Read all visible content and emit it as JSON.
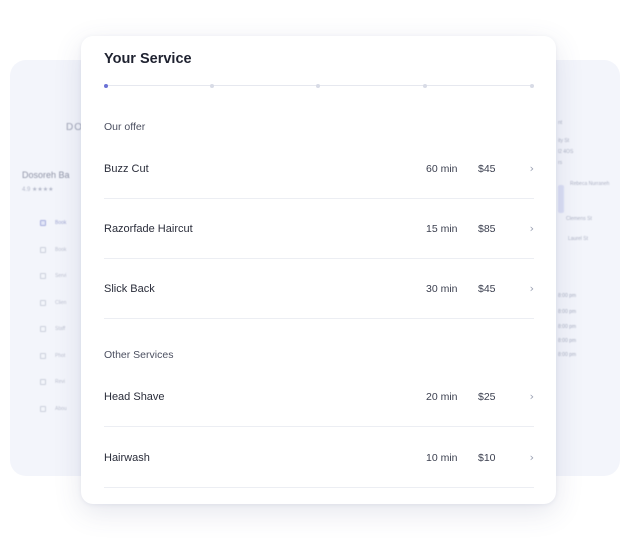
{
  "background": {
    "brand": "DO",
    "business_name": "Dosoreh Ba",
    "rating": "4.9 ★★★★",
    "nav_items": [
      "Book",
      "Book",
      "Servi",
      "Clien",
      "Staff",
      "Phot",
      "Revi",
      "Abou"
    ],
    "right_panel": {
      "lines": [
        "nt",
        "ity St",
        "l2 4OS",
        "rs"
      ],
      "legend": [
        "Rebeca Nurraneh",
        "Clemens St",
        "Laurel St"
      ],
      "times": [
        "8:00 pm",
        "8:00 pm",
        "8:00 pm",
        "8:00 pm",
        "8:00 pm"
      ]
    }
  },
  "card": {
    "title": "Your Service",
    "progress": {
      "steps": 5,
      "active_step": 1
    },
    "sections": [
      {
        "label": "Our offer",
        "services": [
          {
            "name": "Buzz Cut",
            "duration": "60 min",
            "price": "$45"
          },
          {
            "name": "Razorfade Haircut",
            "duration": "15 min",
            "price": "$85"
          },
          {
            "name": "Slick Back",
            "duration": "30 min",
            "price": "$45"
          }
        ]
      },
      {
        "label": "Other Services",
        "services": [
          {
            "name": "Head Shave",
            "duration": "20 min",
            "price": "$25"
          },
          {
            "name": "Hairwash",
            "duration": "10 min",
            "price": "$10"
          }
        ]
      }
    ],
    "chevron": "›"
  },
  "colors": {
    "accent": "#6b72d6",
    "background_panel": "#f3f5fb",
    "divider": "#eceef3"
  }
}
